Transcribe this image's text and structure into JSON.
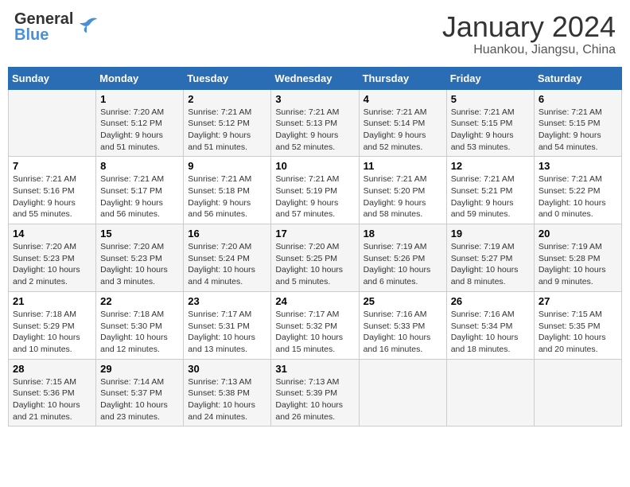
{
  "header": {
    "logo_line1": "General",
    "logo_line2": "Blue",
    "month_title": "January 2024",
    "location": "Huankou, Jiangsu, China"
  },
  "columns": [
    "Sunday",
    "Monday",
    "Tuesday",
    "Wednesday",
    "Thursday",
    "Friday",
    "Saturday"
  ],
  "weeks": [
    [
      {
        "day": "",
        "info": ""
      },
      {
        "day": "1",
        "info": "Sunrise: 7:20 AM\nSunset: 5:12 PM\nDaylight: 9 hours\nand 51 minutes."
      },
      {
        "day": "2",
        "info": "Sunrise: 7:21 AM\nSunset: 5:12 PM\nDaylight: 9 hours\nand 51 minutes."
      },
      {
        "day": "3",
        "info": "Sunrise: 7:21 AM\nSunset: 5:13 PM\nDaylight: 9 hours\nand 52 minutes."
      },
      {
        "day": "4",
        "info": "Sunrise: 7:21 AM\nSunset: 5:14 PM\nDaylight: 9 hours\nand 52 minutes."
      },
      {
        "day": "5",
        "info": "Sunrise: 7:21 AM\nSunset: 5:15 PM\nDaylight: 9 hours\nand 53 minutes."
      },
      {
        "day": "6",
        "info": "Sunrise: 7:21 AM\nSunset: 5:15 PM\nDaylight: 9 hours\nand 54 minutes."
      }
    ],
    [
      {
        "day": "7",
        "info": "Sunrise: 7:21 AM\nSunset: 5:16 PM\nDaylight: 9 hours\nand 55 minutes."
      },
      {
        "day": "8",
        "info": "Sunrise: 7:21 AM\nSunset: 5:17 PM\nDaylight: 9 hours\nand 56 minutes."
      },
      {
        "day": "9",
        "info": "Sunrise: 7:21 AM\nSunset: 5:18 PM\nDaylight: 9 hours\nand 56 minutes."
      },
      {
        "day": "10",
        "info": "Sunrise: 7:21 AM\nSunset: 5:19 PM\nDaylight: 9 hours\nand 57 minutes."
      },
      {
        "day": "11",
        "info": "Sunrise: 7:21 AM\nSunset: 5:20 PM\nDaylight: 9 hours\nand 58 minutes."
      },
      {
        "day": "12",
        "info": "Sunrise: 7:21 AM\nSunset: 5:21 PM\nDaylight: 9 hours\nand 59 minutes."
      },
      {
        "day": "13",
        "info": "Sunrise: 7:21 AM\nSunset: 5:22 PM\nDaylight: 10 hours\nand 0 minutes."
      }
    ],
    [
      {
        "day": "14",
        "info": "Sunrise: 7:20 AM\nSunset: 5:23 PM\nDaylight: 10 hours\nand 2 minutes."
      },
      {
        "day": "15",
        "info": "Sunrise: 7:20 AM\nSunset: 5:23 PM\nDaylight: 10 hours\nand 3 minutes."
      },
      {
        "day": "16",
        "info": "Sunrise: 7:20 AM\nSunset: 5:24 PM\nDaylight: 10 hours\nand 4 minutes."
      },
      {
        "day": "17",
        "info": "Sunrise: 7:20 AM\nSunset: 5:25 PM\nDaylight: 10 hours\nand 5 minutes."
      },
      {
        "day": "18",
        "info": "Sunrise: 7:19 AM\nSunset: 5:26 PM\nDaylight: 10 hours\nand 6 minutes."
      },
      {
        "day": "19",
        "info": "Sunrise: 7:19 AM\nSunset: 5:27 PM\nDaylight: 10 hours\nand 8 minutes."
      },
      {
        "day": "20",
        "info": "Sunrise: 7:19 AM\nSunset: 5:28 PM\nDaylight: 10 hours\nand 9 minutes."
      }
    ],
    [
      {
        "day": "21",
        "info": "Sunrise: 7:18 AM\nSunset: 5:29 PM\nDaylight: 10 hours\nand 10 minutes."
      },
      {
        "day": "22",
        "info": "Sunrise: 7:18 AM\nSunset: 5:30 PM\nDaylight: 10 hours\nand 12 minutes."
      },
      {
        "day": "23",
        "info": "Sunrise: 7:17 AM\nSunset: 5:31 PM\nDaylight: 10 hours\nand 13 minutes."
      },
      {
        "day": "24",
        "info": "Sunrise: 7:17 AM\nSunset: 5:32 PM\nDaylight: 10 hours\nand 15 minutes."
      },
      {
        "day": "25",
        "info": "Sunrise: 7:16 AM\nSunset: 5:33 PM\nDaylight: 10 hours\nand 16 minutes."
      },
      {
        "day": "26",
        "info": "Sunrise: 7:16 AM\nSunset: 5:34 PM\nDaylight: 10 hours\nand 18 minutes."
      },
      {
        "day": "27",
        "info": "Sunrise: 7:15 AM\nSunset: 5:35 PM\nDaylight: 10 hours\nand 20 minutes."
      }
    ],
    [
      {
        "day": "28",
        "info": "Sunrise: 7:15 AM\nSunset: 5:36 PM\nDaylight: 10 hours\nand 21 minutes."
      },
      {
        "day": "29",
        "info": "Sunrise: 7:14 AM\nSunset: 5:37 PM\nDaylight: 10 hours\nand 23 minutes."
      },
      {
        "day": "30",
        "info": "Sunrise: 7:13 AM\nSunset: 5:38 PM\nDaylight: 10 hours\nand 24 minutes."
      },
      {
        "day": "31",
        "info": "Sunrise: 7:13 AM\nSunset: 5:39 PM\nDaylight: 10 hours\nand 26 minutes."
      },
      {
        "day": "",
        "info": ""
      },
      {
        "day": "",
        "info": ""
      },
      {
        "day": "",
        "info": ""
      }
    ]
  ]
}
